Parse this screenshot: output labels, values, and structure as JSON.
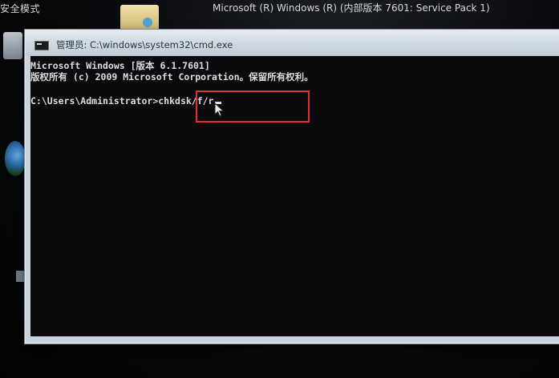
{
  "desktop": {
    "safe_mode_label": "安全模式",
    "build_label": "Microsoft (R) Windows (R) (内部版本 7601: Service Pack 1)"
  },
  "window": {
    "title": "管理员: C:\\windows\\system32\\cmd.exe",
    "console": {
      "version_line": "Microsoft Windows [版本 6.1.7601]",
      "copyright_line": "版权所有 (c) 2009 Microsoft Corporation。保留所有权利。",
      "prompt": "C:\\Users\\Administrator>",
      "command": "chkdsk/f/r"
    }
  },
  "colors": {
    "console_bg": "#0b0b0d",
    "console_text": "#d9dde0",
    "highlight": "#e03030"
  },
  "icons": [
    "console-app-icon",
    "mouse-pointer-icon"
  ]
}
